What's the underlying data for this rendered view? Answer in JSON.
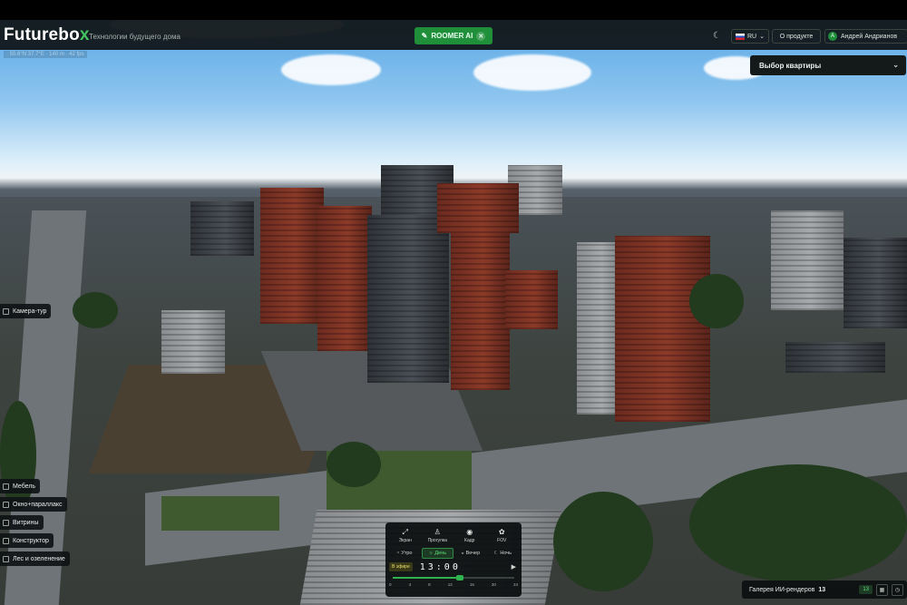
{
  "header": {
    "logo_main": "Futurebo",
    "logo_accent": "x",
    "tagline": "Технологии будущего дома",
    "roomer_label": "ROOMER AI",
    "lang_code": "RU",
    "about_label": "О продукте",
    "user_initial": "А",
    "user_name": "Андрей Андрианов"
  },
  "viewport": {
    "coords_readout": "· 55.6°N 37.7°E · 140 m · 42 fps"
  },
  "apartment_select": {
    "label": "Выбор квартиры"
  },
  "left_tools": [
    "Камера-тур",
    "Мебель",
    "Окно+параллакс",
    "Витрины",
    "Конструктор",
    "Лес и озеленение"
  ],
  "control_panel": {
    "modes": [
      {
        "icon": "⤢",
        "label": "Экран"
      },
      {
        "icon": "♙",
        "label": "Прогулка"
      },
      {
        "icon": "◉",
        "label": "Кадр"
      },
      {
        "icon": "✿",
        "label": "FOV"
      }
    ],
    "times_of_day": [
      {
        "icon": "◔",
        "label": "Утро",
        "active": false
      },
      {
        "icon": "☼",
        "label": "День",
        "active": true
      },
      {
        "icon": "◒",
        "label": "Вечер",
        "active": false
      },
      {
        "icon": "☾",
        "label": "Ночь",
        "active": false
      }
    ],
    "live_badge": "В эфире",
    "time_value": "13:00",
    "slider_value": 0.55,
    "ticks": [
      "0",
      "4",
      "8",
      "12",
      "16",
      "20",
      "24"
    ]
  },
  "gallery": {
    "label": "Галерея ИИ-рендеров",
    "count": "13",
    "chip": "13"
  },
  "colors": {
    "accent": "#1f8f3a",
    "panel_bg": "#0e1214"
  }
}
